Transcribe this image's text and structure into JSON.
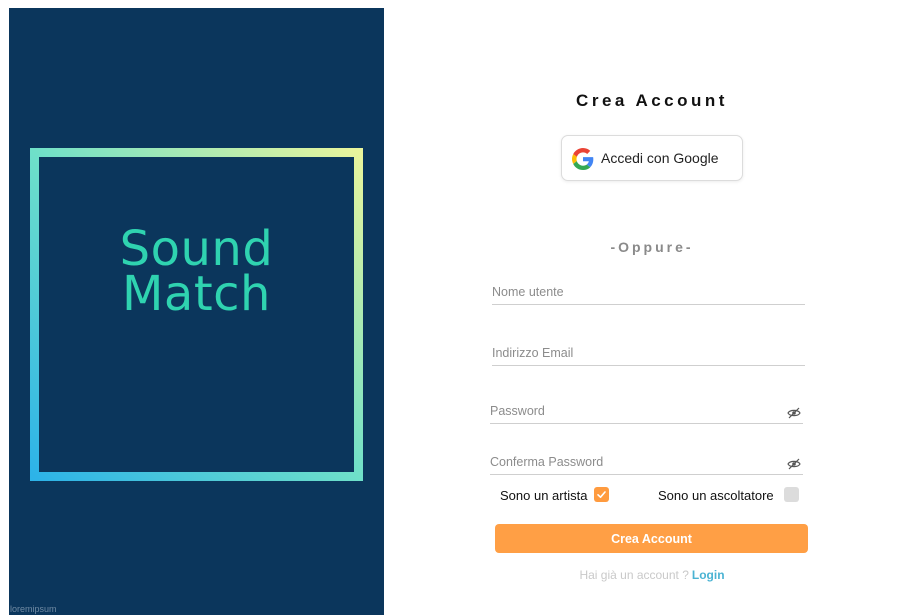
{
  "brand": {
    "line1": "Sound",
    "line2": "Match",
    "footnote": "loremipsum"
  },
  "form": {
    "title": "Crea  Account",
    "google_label": "Accedi con Google",
    "divider": "-Oppure-",
    "username_placeholder": "Nome utente",
    "email_placeholder": "Indirizzo Email",
    "password_placeholder": "Password",
    "confirm_placeholder": "Conferma Password",
    "artist_label": "Sono un artista",
    "artist_checked": true,
    "listener_label": "Sono un ascoltatore",
    "listener_checked": false,
    "submit_label": "Crea Account",
    "login_question": "Hai già un  account ?",
    "login_link": "Login"
  },
  "icons": {
    "google": "google-icon",
    "eye_hidden": "eye-slash-icon",
    "check": "check-icon"
  },
  "colors": {
    "panel_bg": "#0b365c",
    "accent_orange": "#ff9f45",
    "link_blue": "#4ab3d3",
    "brand_teal": "#2fd3b0"
  }
}
